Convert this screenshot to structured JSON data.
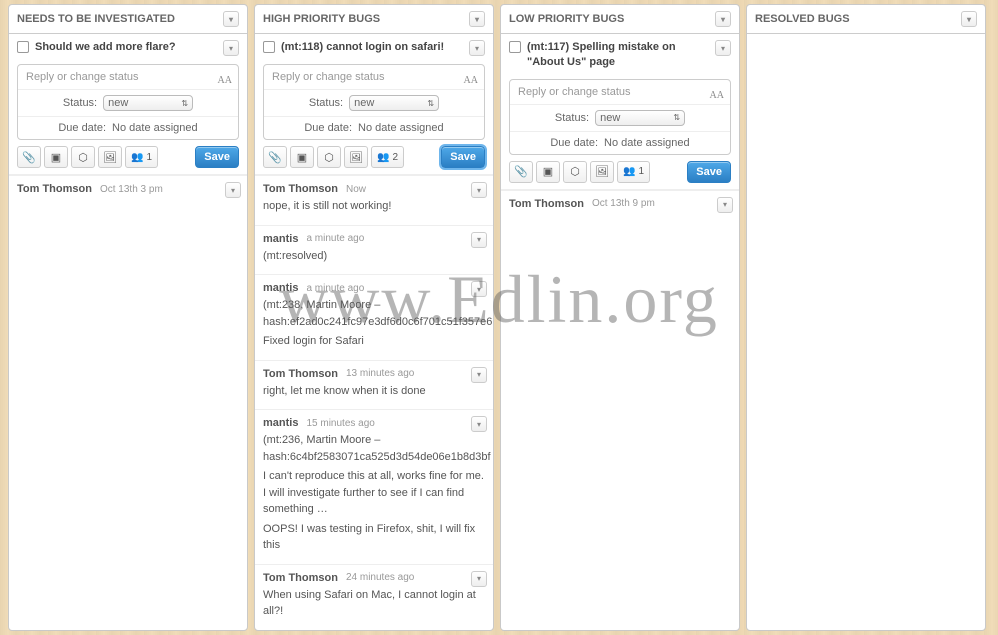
{
  "watermark": "www.Edlin.org",
  "common": {
    "reply_placeholder": "Reply or change status",
    "status_label": "Status:",
    "due_label": "Due date:",
    "due_value": "No date assigned",
    "save": "Save",
    "status_value": "new"
  },
  "columns": [
    {
      "title": "NEEDS TO BE INVESTIGATED",
      "card": {
        "title": "Should we add more flare?",
        "people_count": "1",
        "save_active": false
      },
      "comments": [
        {
          "author": "Tom Thomson",
          "time": "Oct 13th 3 pm",
          "body": []
        }
      ]
    },
    {
      "title": "HIGH PRIORITY BUGS",
      "card": {
        "title": "(mt:118) cannot login on safari!",
        "people_count": "2",
        "save_active": true
      },
      "comments": [
        {
          "author": "Tom Thomson",
          "time": "Now",
          "body": [
            "nope, it is still not working!"
          ]
        },
        {
          "author": "mantis",
          "time": "a minute ago",
          "body": [
            "(mt:resolved)"
          ]
        },
        {
          "author": "mantis",
          "time": "a minute ago",
          "body": [
            "(mt:238, Martin Moore – hash:ef2ad0c241fc97e3df6d0c6f701c51f357e6",
            "Fixed login for Safari"
          ]
        },
        {
          "author": "Tom Thomson",
          "time": "13 minutes ago",
          "body": [
            "right, let me know when it is done"
          ]
        },
        {
          "author": "mantis",
          "time": "15 minutes ago",
          "body": [
            "(mt:236, Martin Moore – hash:6c4bf2583071ca525d3d54de06e1b8d3bf",
            "I can't reproduce this at all, works fine for me. I will investigate further to see if I can find something …",
            "OOPS! I was testing in Firefox, shit, I will fix this"
          ]
        },
        {
          "author": "Tom Thomson",
          "time": "24 minutes ago",
          "body": [
            "When using Safari on Mac, I cannot login at all?!"
          ]
        }
      ]
    },
    {
      "title": "LOW PRIORITY BUGS",
      "card": {
        "title": "(mt:117) Spelling mistake on \"About Us\" page",
        "people_count": "1",
        "save_active": false
      },
      "comments": [
        {
          "author": "Tom Thomson",
          "time": "Oct 13th 9 pm",
          "body": []
        }
      ]
    },
    {
      "title": "RESOLVED BUGS",
      "card": null,
      "comments": []
    }
  ]
}
